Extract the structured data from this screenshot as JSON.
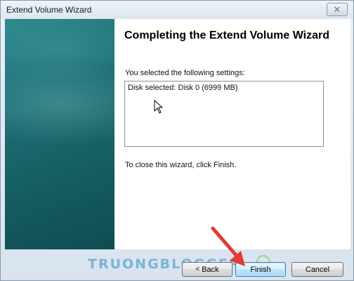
{
  "window": {
    "title": "Extend Volume Wizard",
    "close_glyph": "✕"
  },
  "page": {
    "heading": "Completing the Extend Volume Wizard",
    "selected_label": "You selected the following settings:",
    "settings_text": "Disk selected: Disk 0 (6999 MB)",
    "close_instruction": "To close this wizard, click Finish."
  },
  "buttons": {
    "back_chevron": "<",
    "back_label": "Back",
    "finish_label": "Finish",
    "cancel_label": "Cancel"
  },
  "watermark": {
    "text": "TRUONGBLOGGER"
  },
  "colors": {
    "side_panel": "#1e7177",
    "arrow": "#e53935",
    "watermark": "#288cc8"
  }
}
